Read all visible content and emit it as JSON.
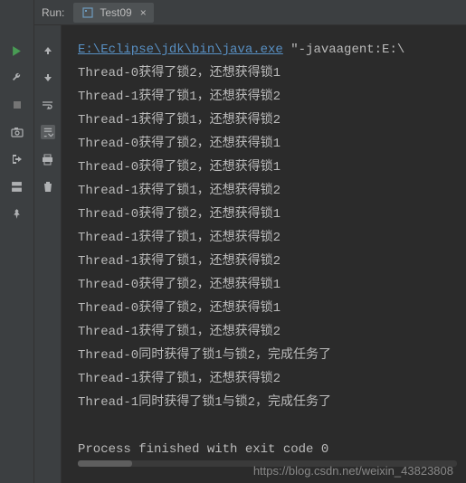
{
  "tabbar": {
    "run_label": "Run:",
    "tab_label": "Test09",
    "close": "×"
  },
  "console": {
    "java_path": "E:\\Eclipse\\jdk\\bin\\java.exe",
    "java_args": " \"-javaagent:E:\\",
    "lines": [
      "Thread-0获得了锁2，还想获得锁1",
      "Thread-1获得了锁1，还想获得锁2",
      "Thread-1获得了锁1，还想获得锁2",
      "Thread-0获得了锁2，还想获得锁1",
      "Thread-0获得了锁2，还想获得锁1",
      "Thread-1获得了锁1，还想获得锁2",
      "Thread-0获得了锁2，还想获得锁1",
      "Thread-1获得了锁1，还想获得锁2",
      "Thread-1获得了锁1，还想获得锁2",
      "Thread-0获得了锁2，还想获得锁1",
      "Thread-0获得了锁2，还想获得锁1",
      "Thread-1获得了锁1，还想获得锁2",
      "Thread-0同时获得了锁1与锁2，完成任务了",
      "Thread-1获得了锁1，还想获得锁2",
      "Thread-1同时获得了锁1与锁2，完成任务了"
    ],
    "exit_line": "Process finished with exit code 0"
  },
  "watermark": "https://blog.csdn.net/weixin_43823808"
}
